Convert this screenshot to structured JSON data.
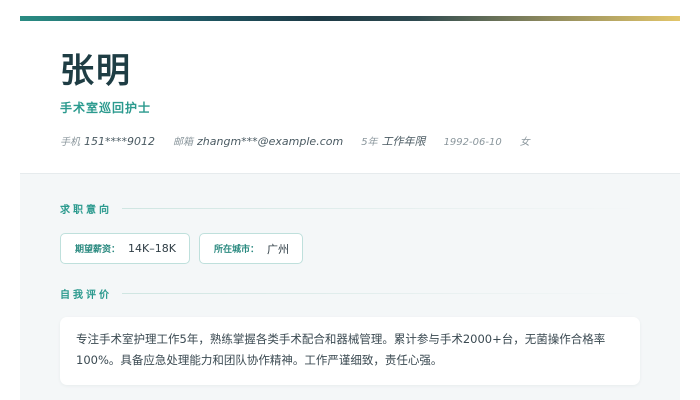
{
  "header": {
    "name": "张明",
    "job_title": "手术室巡回护士",
    "contact": {
      "phone_label": "手机",
      "phone_value": "151****9012",
      "email_label": "邮箱",
      "email_value": "zhangm***@example.com",
      "experience_years": "5年",
      "experience_label": "工作年限",
      "birth_date": "1992-06-10",
      "gender": "女"
    }
  },
  "sections": {
    "job_intention": {
      "title": "求职意向",
      "tags": [
        {
          "label": "期望薪资：",
          "value": "14K–18K"
        },
        {
          "label": "所在城市：",
          "value": "广州"
        }
      ]
    },
    "self_evaluation": {
      "title": "自我评价",
      "text": "专注手术室护理工作5年，熟练掌握各类手术配合和器械管理。累计参与手术2000+台，无菌操作合格率100%。具备应急处理能力和团队协作精神。工作严谨细致，责任心强。"
    }
  },
  "colors": {
    "accent": "#2b9a8e",
    "name_text": "#1e3d44",
    "bar_start": "#2a8c83",
    "bar_mid": "#1d3a46",
    "bar_end": "#e3c66a",
    "body_background": "#f4f7f8"
  }
}
